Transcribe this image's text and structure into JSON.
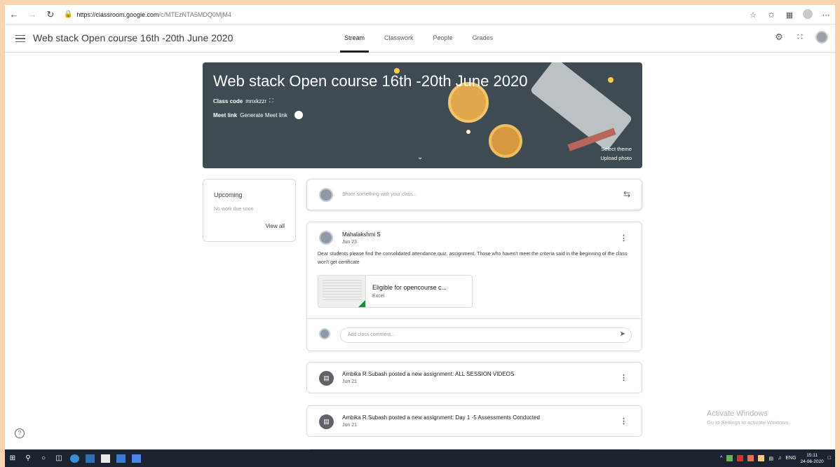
{
  "browser": {
    "url_host": "https://classroom.google.com",
    "url_path": "/c/MTEzNTA5MDQ0MjM4"
  },
  "app": {
    "title": "Web stack Open course 16th -20th June 2020",
    "tabs": [
      {
        "label": "Stream",
        "active": true
      },
      {
        "label": "Classwork",
        "active": false
      },
      {
        "label": "People",
        "active": false
      },
      {
        "label": "Grades",
        "active": false
      }
    ]
  },
  "banner": {
    "title": "Web stack Open course 16th -20th June 2020",
    "class_code_label": "Class code",
    "class_code": "mnxkzzr",
    "meet_label": "Meet link",
    "meet_value": "Generate Meet link",
    "select_theme": "Select theme",
    "upload_photo": "Upload photo"
  },
  "upcoming": {
    "title": "Upcoming",
    "empty": "No work due soon",
    "view_all": "View all"
  },
  "share": {
    "placeholder": "Share something with your class..."
  },
  "post": {
    "author": "Mahalakshmi S",
    "date": "Jun 23",
    "body": "Dear students please find the consolidated attendance,quiz, assignment. Those who haven't meet the criteria said in the beginning of the class won't get certificate",
    "attachment_title": "Eligible for opencourse c...",
    "attachment_type": "Excel",
    "comment_placeholder": "Add class comment..."
  },
  "assignments": [
    {
      "text": "Ambika R.Subash posted a new assignment: ALL SESSION VIDEOS",
      "date": "Jun 21"
    },
    {
      "text": "Ambika R.Subash posted a new assignment: Day 1 -5 Assessments Conducted",
      "date": "Jun 21"
    }
  ],
  "watermark": {
    "line1": "Activate Windows",
    "line2": "Go to Settings to activate Windows."
  },
  "taskbar": {
    "lang": "ENG",
    "time": "15:11",
    "date": "24-06-2020"
  },
  "colors": {
    "banner_bg": "#3f4b52",
    "accent_gold": "#fbcb43",
    "excel_green": "#1e8e3e",
    "taskbar_bg": "#1b2331"
  }
}
